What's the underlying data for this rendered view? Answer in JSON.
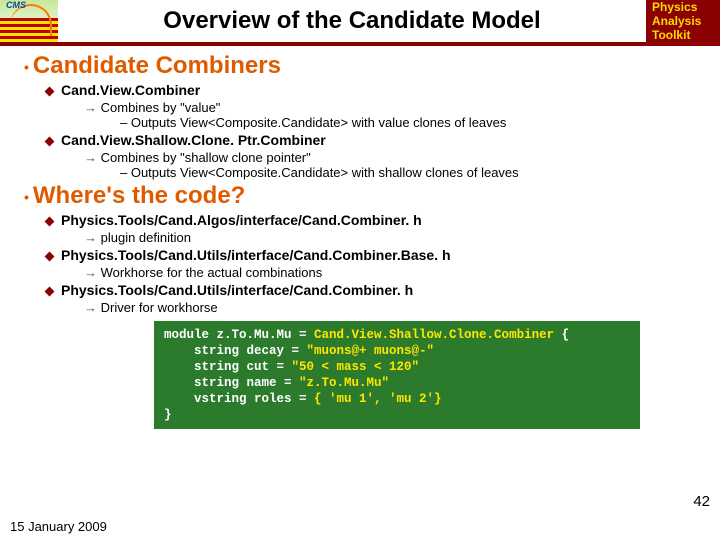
{
  "header": {
    "logo_text": "CMS",
    "title": "Overview of the Candidate Model",
    "tag_l1": "Physics",
    "tag_l2": "Analysis",
    "tag_l3": "Toolkit"
  },
  "section1": {
    "heading": "Candidate Combiners",
    "item1": {
      "name": "Cand.View.Combiner",
      "sub": "Combines by \"value\"",
      "out": "Outputs View<Composite.Candidate> with value clones of leaves"
    },
    "item2": {
      "name": "Cand.View.Shallow.Clone. Ptr.Combiner",
      "sub": "Combines by \"shallow clone pointer\"",
      "out": "Outputs View<Composite.Candidate> with shallow clones of leaves"
    }
  },
  "section2": {
    "heading": "Where's the code?",
    "item1": {
      "name": "Physics.Tools/Cand.Algos/interface/Cand.Combiner. h",
      "sub": "plugin definition"
    },
    "item2": {
      "name": "Physics.Tools/Cand.Utils/interface/Cand.Combiner.Base. h",
      "sub": "Workhorse for the actual combinations"
    },
    "item3": {
      "name": "Physics.Tools/Cand.Utils/interface/Cand.Combiner. h",
      "sub": "Driver for workhorse"
    }
  },
  "code": {
    "l1a": "module z.To.Mu.Mu = ",
    "l1b": "Cand.View.Shallow.Clone.Combiner",
    "l1c": " {",
    "l2a": "    string decay = ",
    "l2b": "\"muons@+ muons@-\"",
    "l3a": "    string cut = ",
    "l3b": "\"50 < mass < 120\"",
    "l4a": "    string name = ",
    "l4b": "\"z.To.Mu.Mu\"",
    "l5a": "    vstring roles = ",
    "l5b": "{ 'mu 1', 'mu 2'}",
    "l6": "}"
  },
  "footer": {
    "date": "15 January 2009",
    "page": "42"
  }
}
